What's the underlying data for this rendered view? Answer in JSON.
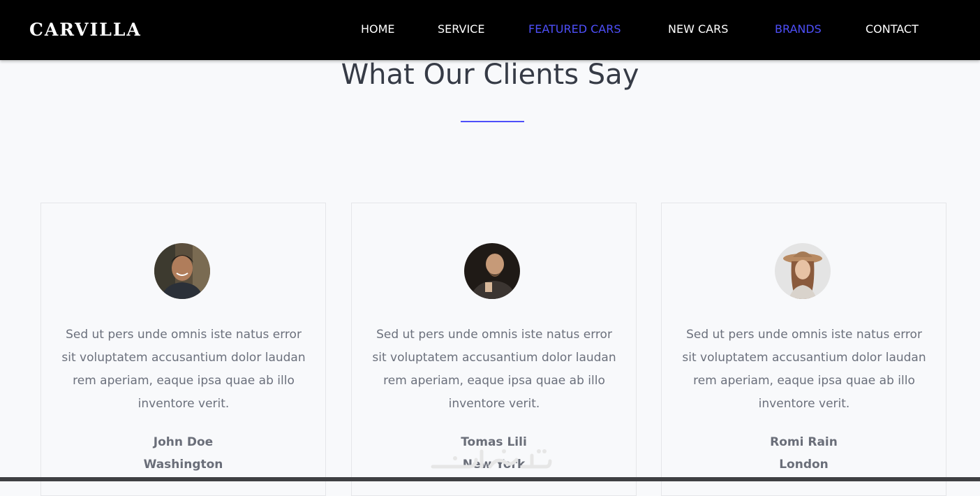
{
  "header": {
    "logo": "CARVILLA",
    "nav": [
      {
        "label": "HOME",
        "active": false
      },
      {
        "label": "SERVICE",
        "active": false
      },
      {
        "label": "FEATURED CARS",
        "active": true
      },
      {
        "label": "NEW CARS",
        "active": false
      },
      {
        "label": "BRANDS",
        "active": true
      },
      {
        "label": "CONTACT",
        "active": false
      }
    ]
  },
  "testimonials": {
    "title": "What Our Clients Say",
    "cards": [
      {
        "quote": "Sed ut pers unde omnis iste natus error sit voluptatem accusantium dolor laudan rem aperiam, eaque ipsa quae ab illo inventore verit.",
        "name": "John Doe",
        "city": "Washington"
      },
      {
        "quote": "Sed ut pers unde omnis iste natus error sit voluptatem accusantium dolor laudan rem aperiam, eaque ipsa quae ab illo inventore verit.",
        "name": "Tomas Lili",
        "city": "New York"
      },
      {
        "quote": "Sed ut pers unde omnis iste natus error sit voluptatem accusantium dolor laudan rem aperiam, eaque ipsa quae ab illo inventore verit.",
        "name": "Romi Rain",
        "city": "London"
      }
    ]
  },
  "colors": {
    "accent": "#4e4ffa",
    "navbar": "#000000",
    "background": "#f8f9fb",
    "title": "#363b46"
  }
}
